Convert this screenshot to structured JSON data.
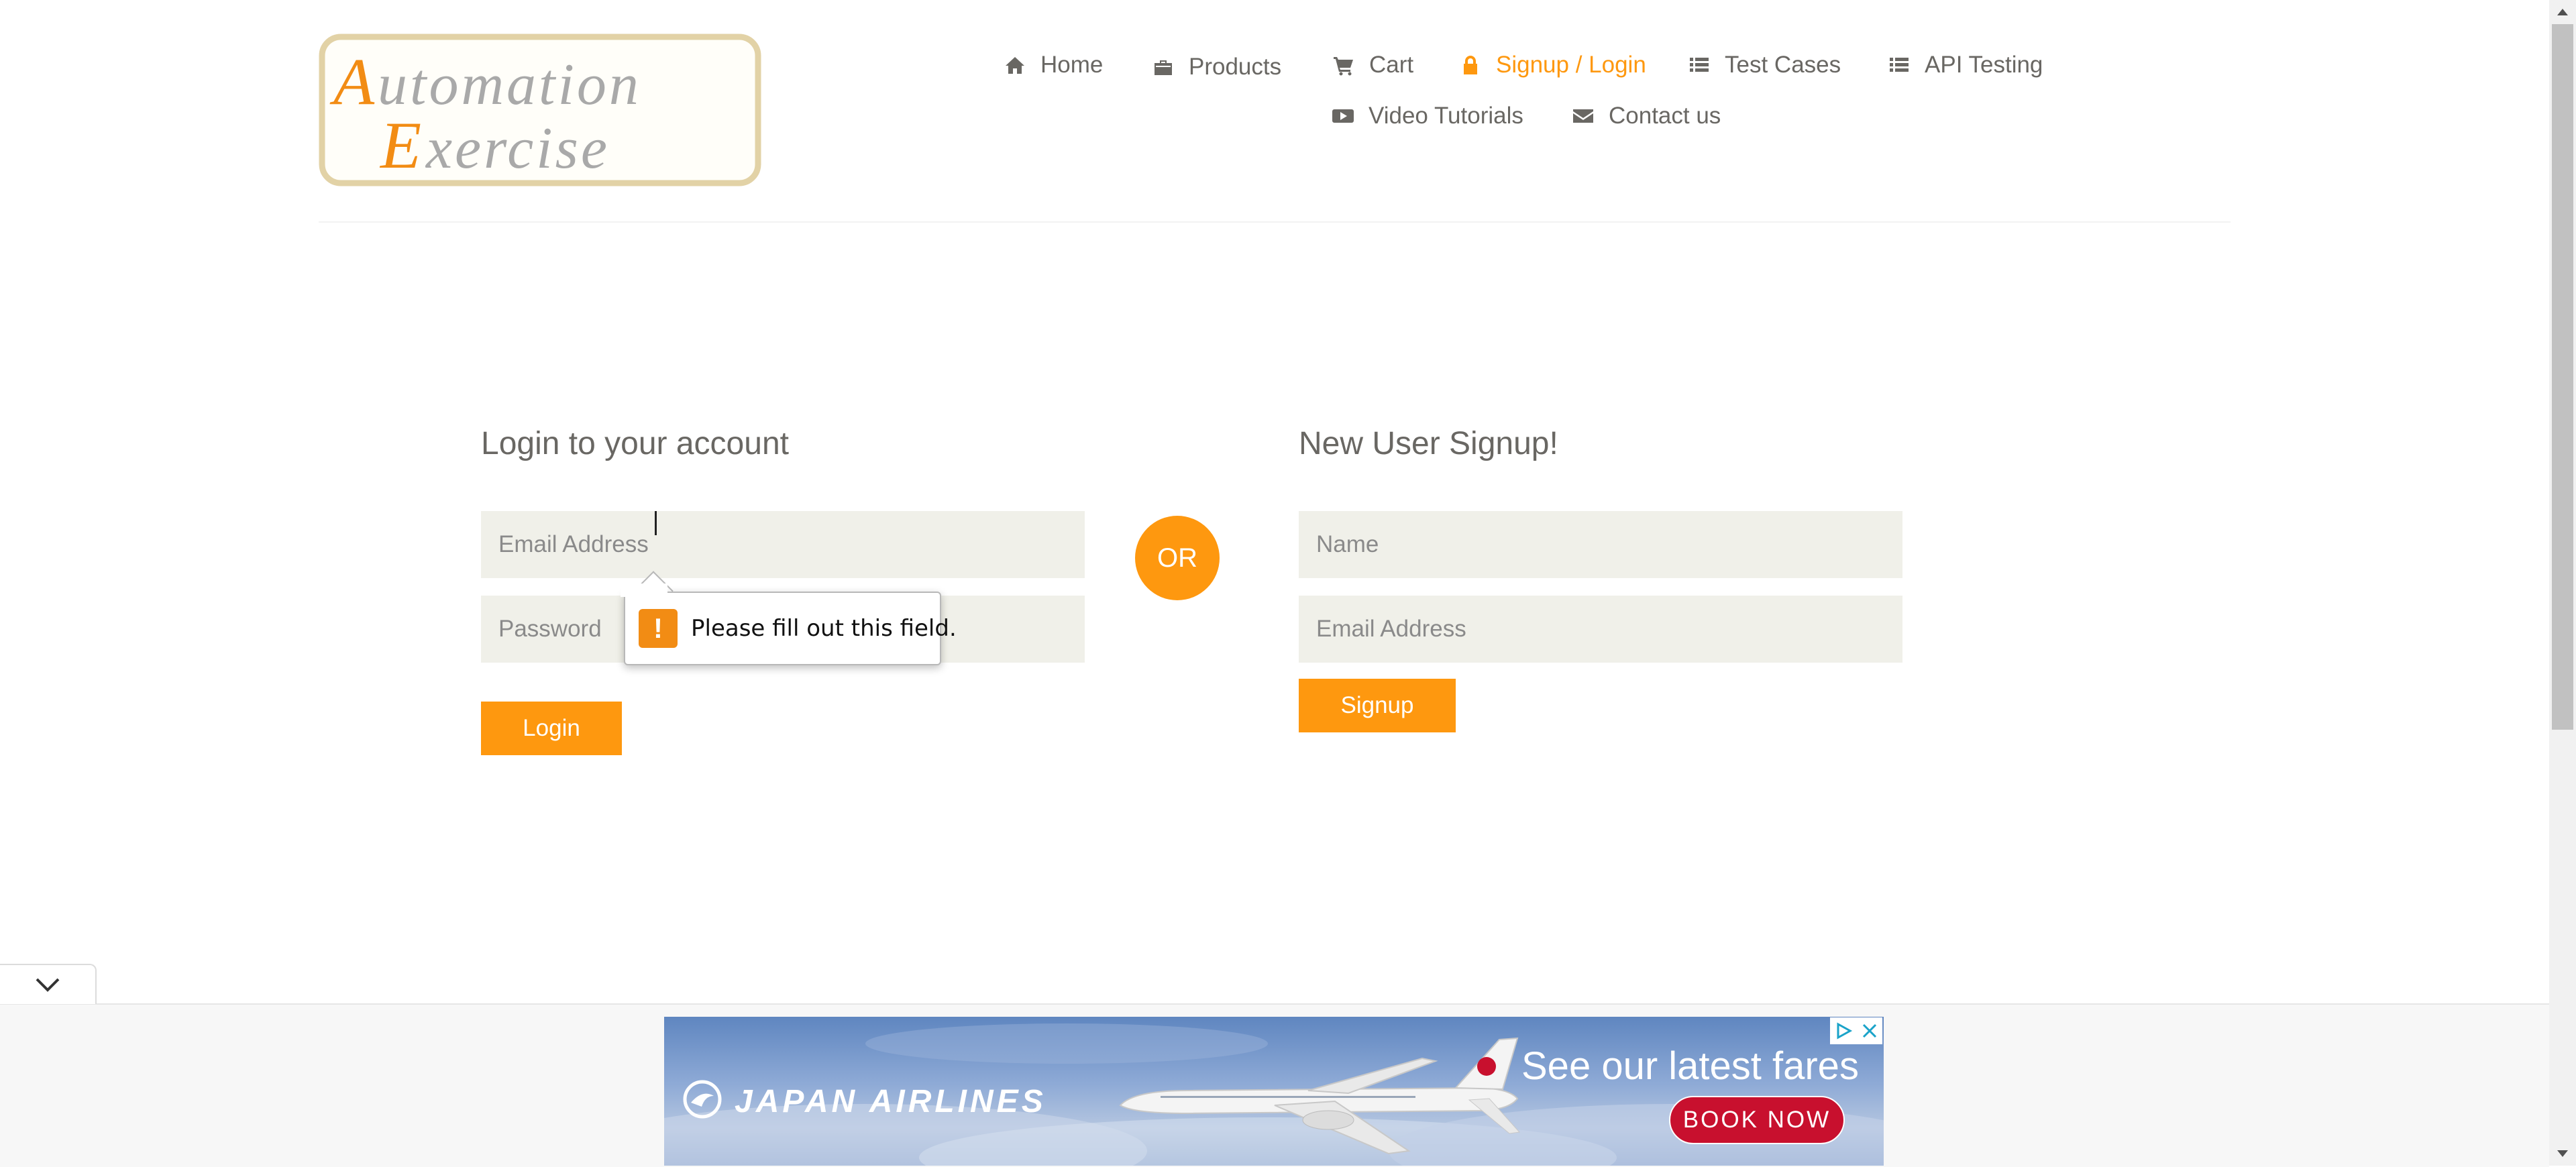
{
  "header": {
    "logo": {
      "first_line": "Automation",
      "second_line": "Exercise",
      "accent_color": "#F28C14"
    },
    "nav": [
      {
        "label": "Home",
        "icon": "home-icon"
      },
      {
        "label": "Products",
        "icon": "briefcase-icon"
      },
      {
        "label": "Cart",
        "icon": "cart-icon"
      },
      {
        "label": "Signup / Login",
        "icon": "lock-icon",
        "active": true
      },
      {
        "label": "Test Cases",
        "icon": "list-icon"
      },
      {
        "label": "API Testing",
        "icon": "list-icon"
      },
      {
        "label": "Video Tutorials",
        "icon": "youtube-icon"
      },
      {
        "label": "Contact us",
        "icon": "envelope-icon"
      }
    ]
  },
  "login": {
    "heading": "Login to your account",
    "email_placeholder": "Email Address",
    "email_value": "",
    "password_placeholder": "Password",
    "button_label": "Login"
  },
  "divider": {
    "label": "OR"
  },
  "signup": {
    "heading": "New User Signup!",
    "name_placeholder": "Name",
    "email_placeholder": "Email Address",
    "button_label": "Signup"
  },
  "validation": {
    "message": "Please fill out this field.",
    "icon": "warning-icon"
  },
  "ad": {
    "brand": "JAPAN AIRLINES",
    "headline": "See our latest fares",
    "cta": "BOOK NOW",
    "choices_icon": "ad-choices-icon",
    "close_icon": "close-icon"
  },
  "colors": {
    "accent": "#FE980F",
    "text": "#696763",
    "field_bg": "#F0F0E9",
    "ad_cta": "#C8102E"
  }
}
